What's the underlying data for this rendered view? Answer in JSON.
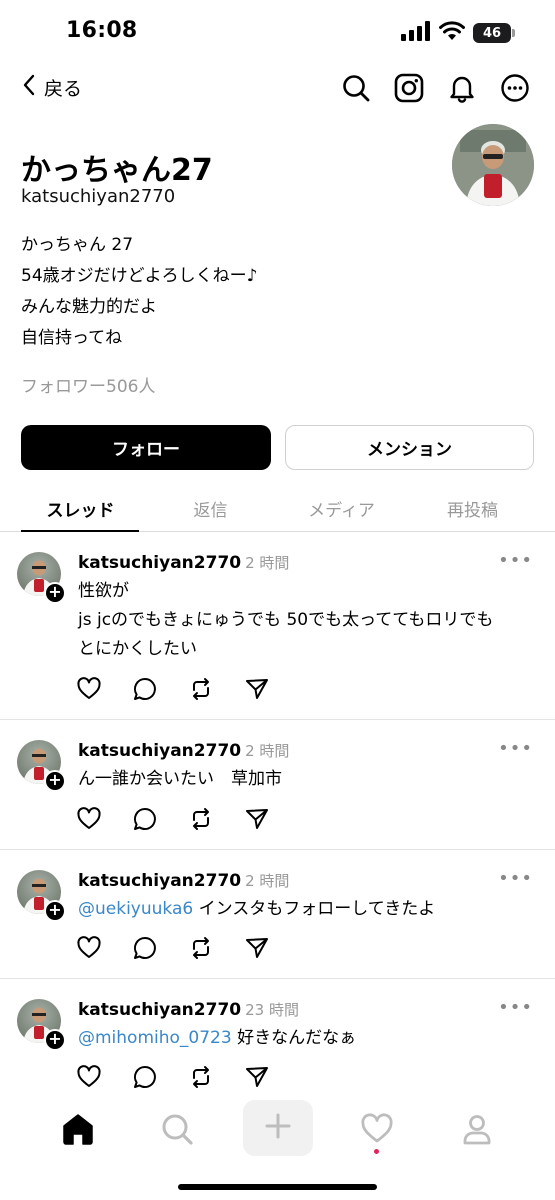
{
  "status_bar": {
    "time": "16:08",
    "battery": "46"
  },
  "nav": {
    "back_label": "戻る",
    "icons": [
      "search-icon",
      "instagram-icon",
      "bell-icon",
      "more-icon"
    ]
  },
  "profile": {
    "name": "かっちゃん27",
    "handle": "katsuchiyan2770",
    "bio_lines": [
      "かっちゃん 27",
      "54歳オジだけどよろしくねー♪",
      "みんな魅力的だよ",
      "自信持ってね"
    ],
    "followers": "フォロワー506人"
  },
  "buttons": {
    "follow": "フォロー",
    "mention": "メンション"
  },
  "tabs": [
    {
      "label": "スレッド",
      "active": true
    },
    {
      "label": "返信",
      "active": false
    },
    {
      "label": "メディア",
      "active": false
    },
    {
      "label": "再投稿",
      "active": false
    }
  ],
  "posts": [
    {
      "user": "katsuchiyan2770",
      "time": "2 時間",
      "mention": "",
      "lines": [
        "性欲が",
        "js jcのでもきょにゅうでも 50でも太っててもロリでも",
        "とにかくしたい"
      ]
    },
    {
      "user": "katsuchiyan2770",
      "time": "2 時間",
      "mention": "",
      "lines": [
        "ん一誰か会いたい　草加市"
      ]
    },
    {
      "user": "katsuchiyan2770",
      "time": "2 時間",
      "mention": "@uekiyuuka6",
      "lines": [
        " インスタもフォローしてきたよ"
      ]
    },
    {
      "user": "katsuchiyan2770",
      "time": "23 時間",
      "mention": "@mihomiho_0723",
      "lines": [
        " 好きなんだなぁ"
      ]
    }
  ],
  "more_glyph": "•••",
  "plus_glyph": "+",
  "colors": {
    "mention": "#3a87c9",
    "notification_dot": "#e0245e",
    "primary": "#000000"
  },
  "bottom_bar": [
    "home-icon",
    "search-icon",
    "plus-icon",
    "heart-icon",
    "profile-icon"
  ]
}
